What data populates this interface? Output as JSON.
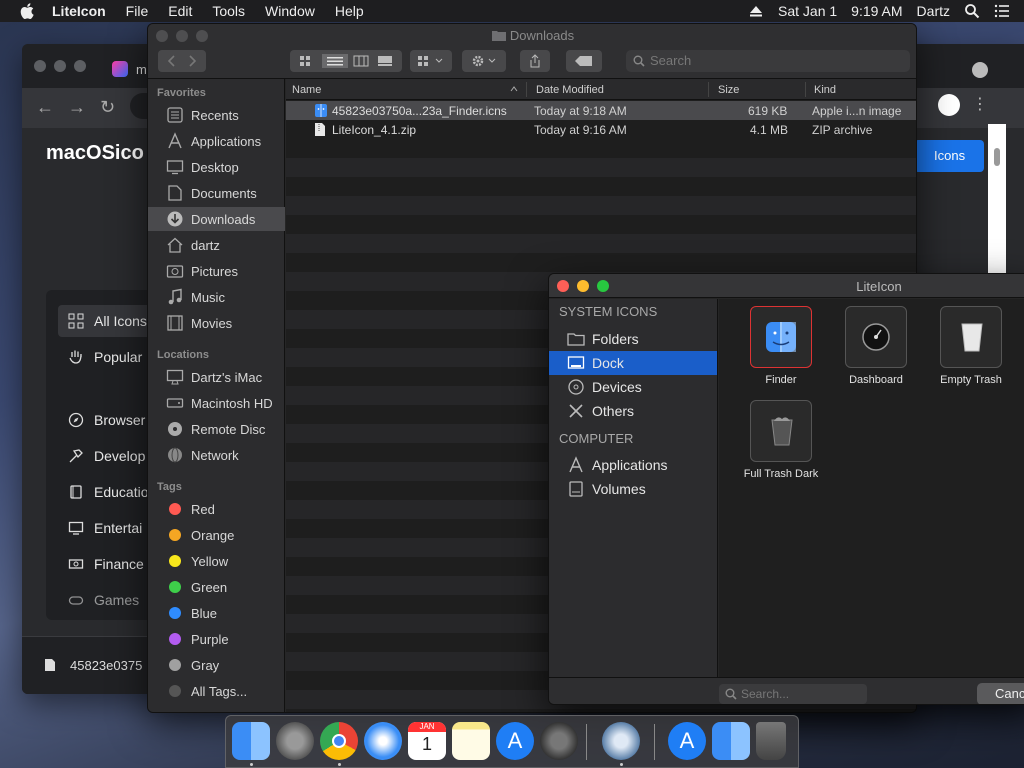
{
  "menubar": {
    "app_name": "LiteIcon",
    "menus": [
      "File",
      "Edit",
      "Tools",
      "Window",
      "Help"
    ],
    "date": "Sat Jan 1",
    "time": "9:19 AM",
    "user": "Dartz"
  },
  "browser": {
    "tab_title": "m",
    "brand": "macOSico",
    "get_button": "Icons",
    "sidebar": [
      {
        "label": "All Icons",
        "icon": "grid-icon"
      },
      {
        "label": "Popular",
        "icon": "hand-icon"
      },
      {
        "label": "Browser",
        "icon": "compass-icon"
      },
      {
        "label": "Develop",
        "icon": "hammer-icon"
      },
      {
        "label": "Educatio",
        "icon": "book-icon"
      },
      {
        "label": "Entertai",
        "icon": "monitor-icon"
      },
      {
        "label": "Finance",
        "icon": "money-icon"
      },
      {
        "label": "Games",
        "icon": "gamepad-icon"
      }
    ],
    "download_item": "45823e0375"
  },
  "finder": {
    "title": "Downloads",
    "search_placeholder": "Search",
    "sections": {
      "favorites": "Favorites",
      "locations": "Locations",
      "tags": "Tags"
    },
    "favorites": [
      "Recents",
      "Applications",
      "Desktop",
      "Documents",
      "Downloads",
      "dartz",
      "Pictures",
      "Music",
      "Movies"
    ],
    "locations": [
      "Dartz's iMac",
      "Macintosh HD",
      "Remote Disc",
      "Network"
    ],
    "tags": [
      {
        "label": "Red",
        "color": "#ff5a52"
      },
      {
        "label": "Orange",
        "color": "#f5a623"
      },
      {
        "label": "Yellow",
        "color": "#f8e71c"
      },
      {
        "label": "Green",
        "color": "#3ecf4a"
      },
      {
        "label": "Blue",
        "color": "#2f8cff"
      },
      {
        "label": "Purple",
        "color": "#b35cf0"
      },
      {
        "label": "Gray",
        "color": "#a0a0a0"
      },
      {
        "label": "All Tags...",
        "color": "#555555"
      }
    ],
    "columns": {
      "name": "Name",
      "date": "Date Modified",
      "size": "Size",
      "kind": "Kind"
    },
    "files": [
      {
        "name": "45823e03750a...23a_Finder.icns",
        "date": "Today at 9:18 AM",
        "size": "619 KB",
        "kind": "Apple i...n image"
      },
      {
        "name": "LiteIcon_4.1.zip",
        "date": "Today at 9:16 AM",
        "size": "4.1 MB",
        "kind": "ZIP archive"
      }
    ]
  },
  "liteicon": {
    "title": "LiteIcon",
    "system_section": "SYSTEM ICONS",
    "computer_section": "COMPUTER",
    "system_items": [
      "Folders",
      "Dock",
      "Devices",
      "Others"
    ],
    "computer_items": [
      "Applications",
      "Volumes"
    ],
    "icons": [
      "Finder",
      "Dashboard",
      "Empty Trash",
      "Full Trash Dark"
    ],
    "search_placeholder": "Search...",
    "cancel": "Canc"
  },
  "dock": {
    "apps": [
      "finder-icon",
      "launchpad-icon",
      "chrome-icon",
      "safari-icon",
      "calendar-icon",
      "notes-icon",
      "app-store-icon",
      "system-preferences-icon",
      "liteicon-icon",
      "app-store-icon",
      "finder-icon",
      "trash-icon"
    ],
    "calendar_month": "JAN",
    "calendar_day": "1"
  }
}
